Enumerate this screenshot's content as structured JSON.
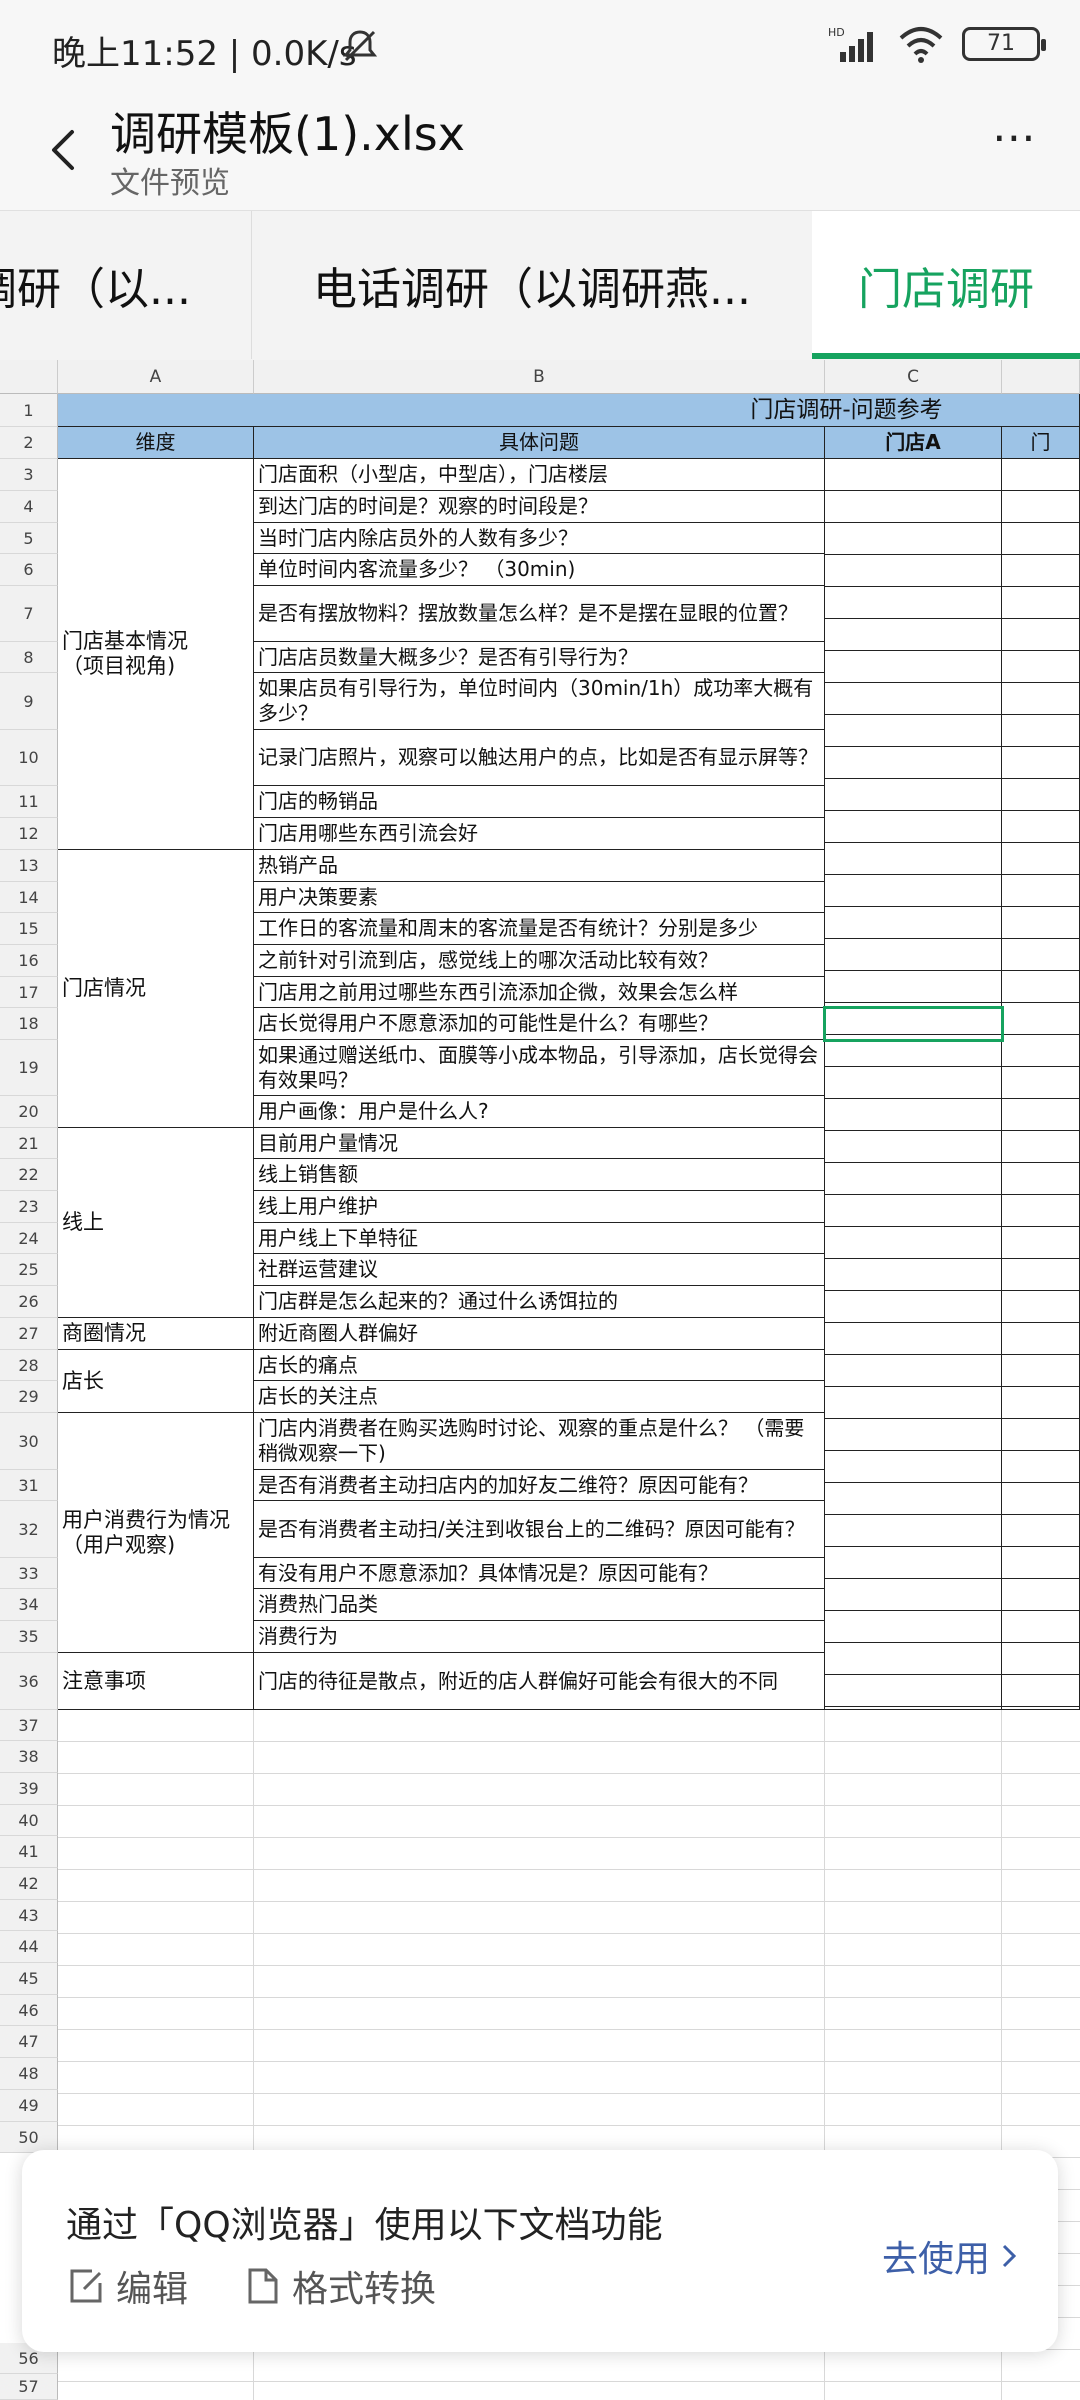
{
  "status_bar": {
    "time_speed": "晚上11:52 | 0.0K/s",
    "battery": "71",
    "net_label": "HD"
  },
  "header": {
    "title": "调研模板(1).xlsx",
    "subtitle": "文件预览"
  },
  "tabs": [
    "调研（以...",
    "电话调研（以调研燕...",
    "门店调研"
  ],
  "columns": [
    "A",
    "B",
    "C"
  ],
  "sheet": {
    "title": "门店调研-问题参考",
    "headers": {
      "dimension": "维度",
      "question": "具体问题",
      "storeA": "门店A",
      "storeB": "门"
    },
    "row_numbers": [
      "1",
      "2",
      "3",
      "4",
      "5",
      "6",
      "7",
      "8",
      "9",
      "10",
      "11",
      "12",
      "13",
      "14",
      "15",
      "16",
      "17",
      "18",
      "19",
      "20",
      "21",
      "22",
      "23",
      "24",
      "25",
      "26",
      "27",
      "28",
      "29",
      "30",
      "31",
      "32",
      "33",
      "34",
      "35",
      "36",
      "37",
      "38",
      "39",
      "40",
      "41",
      "42",
      "43",
      "44",
      "45",
      "46",
      "47",
      "48",
      "49",
      "50",
      "56",
      "57"
    ],
    "dimensions": [
      "门店基本情况\n（项目视角)",
      "门店情况",
      "线上",
      "商圈情况",
      "店长",
      "用户消费行为情况\n（用户观察)",
      "注意事项"
    ],
    "questions": [
      "门店面积（小型店，中型店），门店楼层",
      "到达门店的时间是？观察的时间段是？",
      "当时门店内除店员外的人数有多少？",
      "单位时间内客流量多少？  （30min)",
      "是否有摆放物料？摆放数量怎么样？是不是摆在显眼的位置？",
      "门店店员数量大概多少？是否有引导行为？",
      "如果店员有引导行为，单位时间内（30min/1h）成功率大概有多少？",
      "记录门店照片，观察可以触达用户的点，比如是否有显示屏等？",
      "门店的畅销品",
      "门店用哪些东西引流会好",
      "热销产品",
      "用户决策要素",
      "工作日的客流量和周末的客流量是否有统计？分别是多少",
      "之前针对引流到店，感觉线上的哪次活动比较有效？",
      "门店用之前用过哪些东西引流添加企微，效果会怎么样",
      "店长觉得用户不愿意添加的可能性是什么？有哪些？",
      "如果通过赠送纸巾、面膜等小成本物品，引导添加，店长觉得会有效果吗？",
      "用户画像：用户是什么人?",
      "目前用户量情况",
      "线上销售额",
      "线上用户维护",
      "用户线上下单特征",
      "社群运营建议",
      "门店群是怎么起来的？通过什么诱饵拉的",
      "附近商圈人群偏好",
      "店长的痛点",
      "店长的关注点",
      "门店内消费者在购买选购时讨论、观察的重点是什么？  （需要稍微观察一下)",
      "是否有消费者主动扫店内的加好友二维符？原因可能有？",
      "是否有消费者主动扫/关注到收银台上的二维码？原因可能有？",
      "有没有用户不愿意添加？具体情况是？原因可能有？",
      "消费热门品类",
      "消费行为",
      "门店的待征是散点，附近的店人群偏好可能会有很大的不同"
    ]
  },
  "promo": {
    "message": "通过「QQ浏览器」使用以下文档功能",
    "edit": "编辑",
    "convert": "格式转换",
    "go": "去使用"
  }
}
